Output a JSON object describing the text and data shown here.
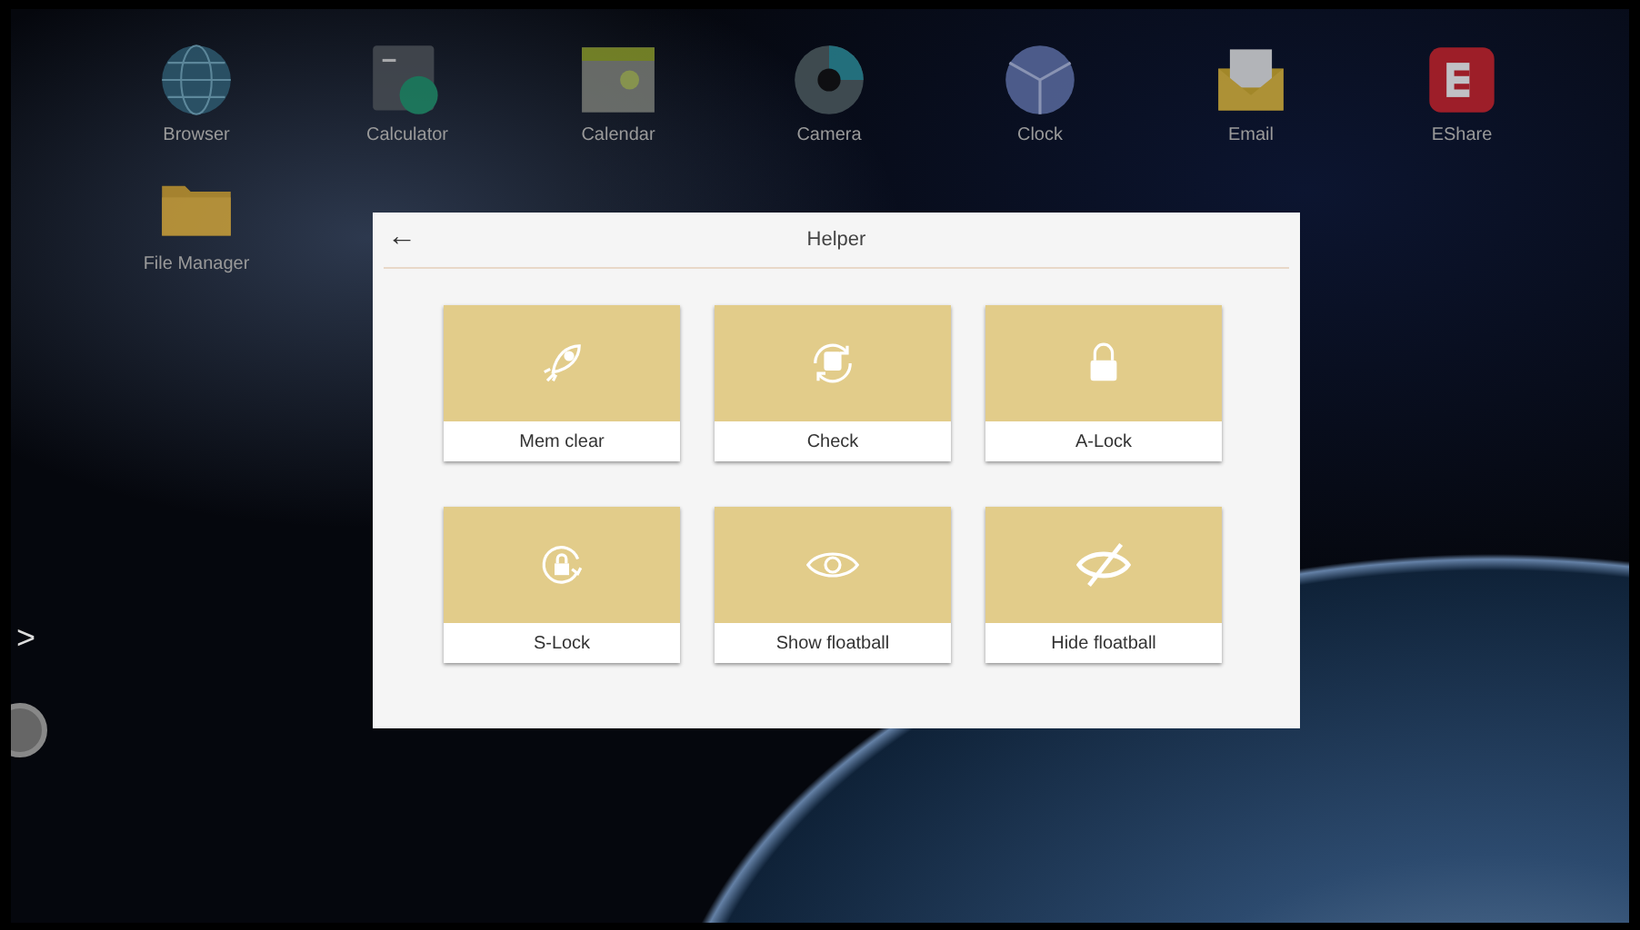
{
  "desktop": {
    "apps": [
      {
        "label": "Browser",
        "kind": "globe"
      },
      {
        "label": "Calculator",
        "kind": "calculator"
      },
      {
        "label": "Calendar",
        "kind": "calendar"
      },
      {
        "label": "Camera",
        "kind": "camera"
      },
      {
        "label": "Clock",
        "kind": "clock"
      },
      {
        "label": "Email",
        "kind": "email"
      },
      {
        "label": "EShare",
        "kind": "eshare"
      },
      {
        "label": "File Manager",
        "kind": "folder"
      }
    ]
  },
  "side_arrow": ">",
  "dialog": {
    "back": "←",
    "title": "Helper",
    "tiles": [
      {
        "label": "Mem clear",
        "kind": "rocket"
      },
      {
        "label": "Check",
        "kind": "check"
      },
      {
        "label": "A-Lock",
        "kind": "lock"
      },
      {
        "label": "S-Lock",
        "kind": "slock"
      },
      {
        "label": "Show floatball",
        "kind": "eye"
      },
      {
        "label": "Hide floatball",
        "kind": "eyeoff"
      }
    ]
  }
}
